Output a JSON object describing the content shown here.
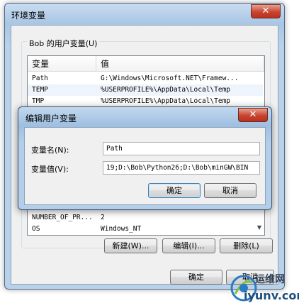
{
  "env_window": {
    "title": "环境变量",
    "close_glyph": "✕",
    "user_vars_legend": "Bob 的用户变量(U)",
    "columns": [
      "变量",
      "值"
    ],
    "rows": [
      {
        "name": "Path",
        "value": "G:\\Windows\\Microsoft.NET\\Framew..."
      },
      {
        "name": "TEMP",
        "value": "%USERPROFILE%\\AppData\\Local\\Temp"
      },
      {
        "name": "TMP",
        "value": "%USERPROFILE%\\AppData\\Local\\Temp"
      },
      {
        "name": "NUMBER_OF_PR...",
        "value": "2"
      },
      {
        "name": "OS",
        "value": "Windows_NT"
      }
    ],
    "buttons": {
      "new": "新建(W)...",
      "edit": "编辑(I)...",
      "delete": "删除(L)",
      "ok": "确定",
      "cancel": "取消"
    }
  },
  "edit_dialog": {
    "title": "编辑用户变量",
    "close_glyph": "✕",
    "name_label": "变量名(N):",
    "name_value": "Path",
    "value_label": "变量值(V):",
    "value_value": "19;D:\\Bob\\Python26;D:\\Bob\\minGW\\BIN",
    "ok": "确定",
    "cancel": "取消"
  },
  "watermark": {
    "top": "运维网",
    "bottom": "iyunv.com"
  },
  "colors": {
    "close_red": "#c84430",
    "frame_blue": "#a9c6e4"
  }
}
